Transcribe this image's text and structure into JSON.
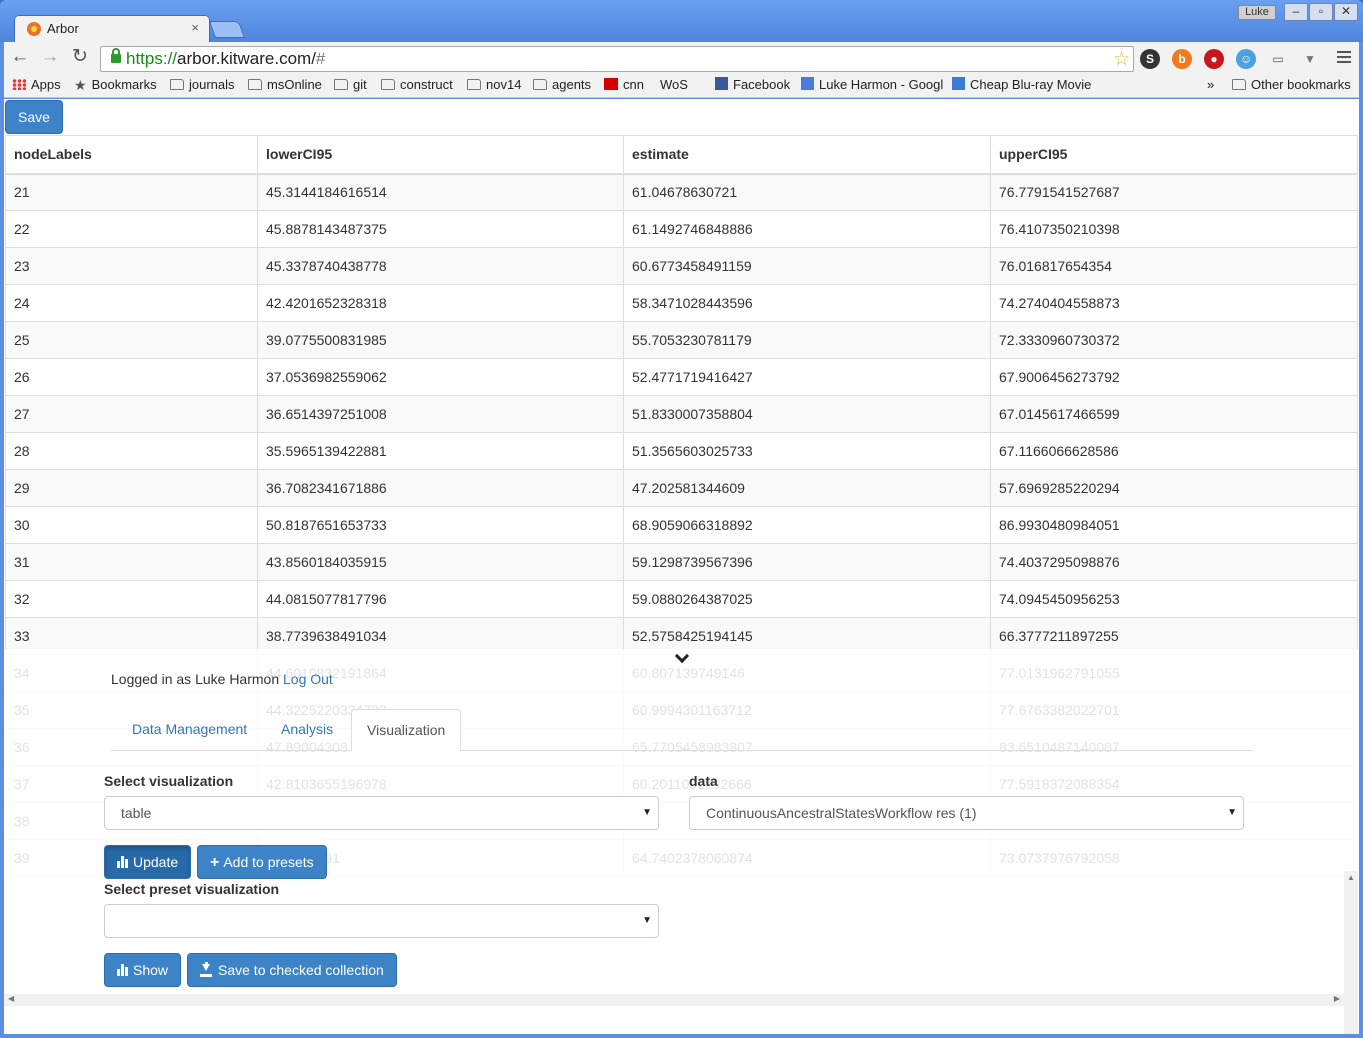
{
  "browser": {
    "tab_title": "Arbor",
    "tab_close": "×",
    "user_name": "Luke",
    "url_scheme": "https://",
    "url_host": "arbor.kitware.com/",
    "url_path": "#",
    "bookmarks": [
      {
        "label": "Apps",
        "icon": "apps-grid-icon"
      },
      {
        "label": "Bookmarks",
        "icon": "star-icon"
      },
      {
        "label": "journals",
        "icon": "folder-icon"
      },
      {
        "label": "msOnline",
        "icon": "folder-icon"
      },
      {
        "label": "git",
        "icon": "folder-icon"
      },
      {
        "label": "construct",
        "icon": "folder-icon"
      },
      {
        "label": "nov14",
        "icon": "folder-icon"
      },
      {
        "label": "agents",
        "icon": "folder-icon"
      },
      {
        "label": "cnn",
        "icon": "cnn-icon"
      },
      {
        "label": "WoS",
        "icon": "page-icon"
      },
      {
        "label": "Facebook",
        "icon": "facebook-icon"
      },
      {
        "label": "Luke Harmon - Googl",
        "icon": "google-scholar-icon"
      },
      {
        "label": "Cheap Blu-ray Movie",
        "icon": "bookmark-b-icon"
      }
    ],
    "bookmarks_overflow": "»",
    "other_bookmarks": "Other bookmarks"
  },
  "page": {
    "save_label": "Save",
    "table": {
      "headers": [
        "nodeLabels",
        "lowerCI95",
        "estimate",
        "upperCI95"
      ],
      "rows": [
        [
          "21",
          "45.3144184616514",
          "61.04678630721",
          "76.7791541527687"
        ],
        [
          "22",
          "45.8878143487375",
          "61.1492746848886",
          "76.4107350210398"
        ],
        [
          "23",
          "45.3378740438778",
          "60.6773458491159",
          "76.016817654354"
        ],
        [
          "24",
          "42.4201652328318",
          "58.3471028443596",
          "74.2740404558873"
        ],
        [
          "25",
          "39.0775500831985",
          "55.7053230781179",
          "72.3330960730372"
        ],
        [
          "26",
          "37.0536982559062",
          "52.4771719416427",
          "67.9006456273792"
        ],
        [
          "27",
          "36.6514397251008",
          "51.8330007358804",
          "67.0145617466599"
        ],
        [
          "28",
          "35.5965139422881",
          "51.3565603025733",
          "67.1166066628586"
        ],
        [
          "29",
          "36.7082341671886",
          "47.202581344609",
          "57.6969285220294"
        ],
        [
          "30",
          "50.8187651653733",
          "68.9059066318892",
          "86.9930480984051"
        ],
        [
          "31",
          "43.8560184035915",
          "59.1298739567396",
          "74.4037295098876"
        ],
        [
          "32",
          "44.0815077817796",
          "59.0880264387025",
          "74.0945450956253"
        ],
        [
          "33",
          "38.7739638491034",
          "52.5758425194145",
          "66.3777211897255"
        ],
        [
          "34",
          "44.6010832191864",
          "60.807139749146",
          "77.0131962791055"
        ],
        [
          "35",
          "44.3225220334733",
          "60.9994301163712",
          "77.6763382022701"
        ],
        [
          "36",
          "47.89004308",
          "65.7705458983807",
          "83.6510487140087"
        ],
        [
          "37",
          "42.8103655196978",
          "60.2011092292666",
          "77.5918372088354"
        ],
        [
          "38",
          "",
          "",
          ""
        ],
        [
          "39",
          "56.3329691",
          "64.7402378060874",
          "73.0737976792058"
        ]
      ]
    }
  },
  "panel": {
    "logged_in_text": "Logged in as Luke Harmon",
    "logout_label": "Log Out",
    "tabs": [
      "Data Management",
      "Analysis",
      "Visualization"
    ],
    "active_tab": "Visualization",
    "select_visualization_label": "Select visualization",
    "select_visualization_value": "table",
    "data_label": "data",
    "data_value": "ContinuousAncestralStatesWorkflow res (1)",
    "update_label": "Update",
    "add_presets_label": "Add to presets",
    "select_preset_label": "Select preset visualization",
    "select_preset_value": "",
    "show_label": "Show",
    "save_collection_label": "Save to checked collection"
  }
}
